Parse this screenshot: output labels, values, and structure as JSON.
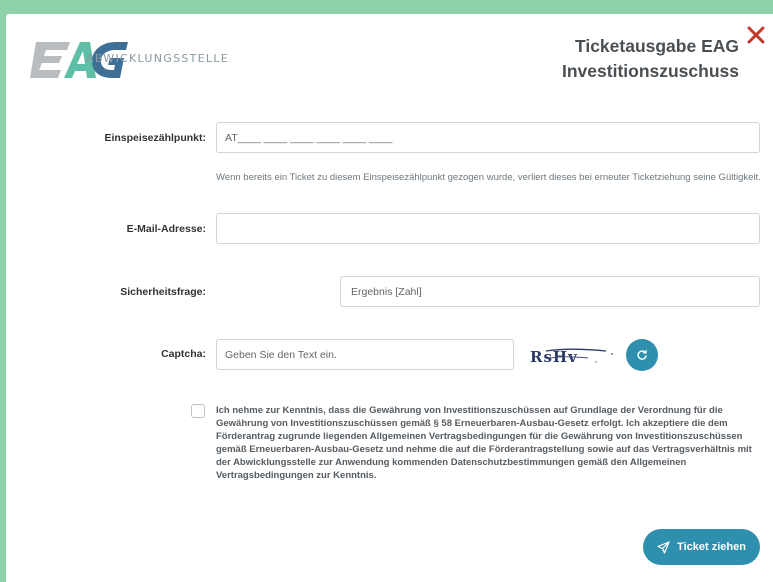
{
  "header": {
    "logo_text": "EAG",
    "logo_subtitle": "ABWICKLUNGSSTELLE",
    "title_line1": "Ticketausgabe EAG",
    "title_line2": "Investitionszuschuss"
  },
  "icons": {
    "close": "close-icon",
    "refresh": "refresh-icon",
    "send": "send-icon"
  },
  "colors": {
    "background": "#8fd3a9",
    "accent": "#2f8fae",
    "close": "#c0392b",
    "logo_gray": "#b9bdc0",
    "logo_teal": "#5fbfa6"
  },
  "form": {
    "zaehlpunkt": {
      "label": "Einspeisezählpunkt:",
      "value": "AT____ ____ ____ ____ ____ ____",
      "hint": "Wenn bereits ein Ticket zu diesem Einspeisezählpunkt gezogen wurde, verliert dieses bei erneuter Ticketziehung seine Gültigkeit."
    },
    "email": {
      "label": "E-Mail-Adresse:",
      "value": ""
    },
    "security": {
      "label": "Sicherheitsfrage:",
      "placeholder": "Ergebnis [Zahl]"
    },
    "captcha": {
      "label": "Captcha:",
      "placeholder": "Geben Sie den Text ein.",
      "image_text": "RsHv"
    },
    "consent_text": "Ich nehme zur Kenntnis, dass die Gewährung von Investitionszuschüssen auf Grundlage der Verordnung für die Gewährung von Investitionszuschüssen gemäß § 58 Erneuerbaren-Ausbau-Gesetz erfolgt. Ich akzeptiere die dem Förderantrag zugrunde liegenden Allgemeinen Vertragsbedingungen für die Gewährung von Investitionszuschüssen gemäß Erneuerbaren-Ausbau-Gesetz und nehme die auf die Förderantragstellung sowie auf das Vertragsverhältnis mit der Abwicklungsstelle zur Anwendung kommenden Datenschutzbestimmungen gemäß den Allgemeinen Vertragsbedingungen zur Kenntnis.",
    "consent_checked": false
  },
  "submit": {
    "label": "Ticket ziehen"
  }
}
